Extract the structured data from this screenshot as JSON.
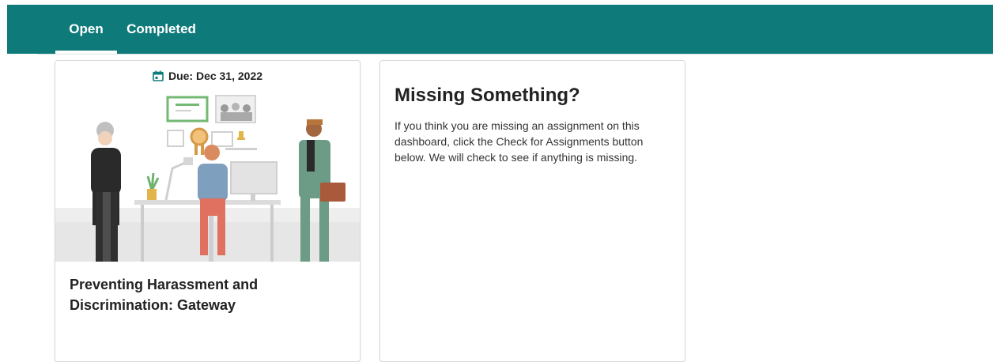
{
  "tabs": [
    {
      "label": "Open"
    },
    {
      "label": "Completed"
    }
  ],
  "assignment": {
    "due": "Due: Dec 31, 2022",
    "title": "Preventing Harassment and Discrimination: Gateway"
  },
  "missing": {
    "title": "Missing Something?",
    "body": "If you think you are missing an assignment on this dashboard, click the Check for Assignments button below. We will check to see if anything is missing."
  },
  "colors": {
    "tab_bar": "#0f7a7a",
    "tab_text": "#ffffff"
  }
}
